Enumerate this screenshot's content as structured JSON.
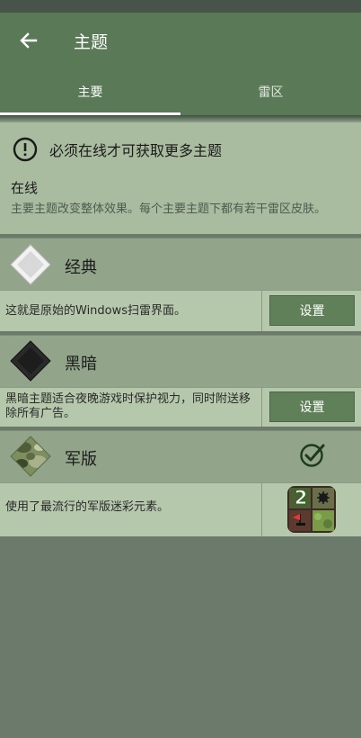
{
  "app": {
    "title": "主题"
  },
  "tabs": [
    {
      "label": "主要"
    },
    {
      "label": "雷区"
    }
  ],
  "notice": {
    "text": "必须在线才可获取更多主题",
    "online_label": "在线",
    "online_desc": "主要主题改变整体效果。每个主要主题下都有若干雷区皮肤。"
  },
  "themes": [
    {
      "name": "经典",
      "desc": "这就是原始的Windows扫雷界面。",
      "button": "设置"
    },
    {
      "name": "黑暗",
      "desc": "黑暗主题适合夜晚游戏时保护视力，同时附送移除所有广告。",
      "button": "设置"
    },
    {
      "name": "军版",
      "desc": "使用了最流行的军版迷彩元素。",
      "badge_number": "2"
    }
  ],
  "icons": [
    "back-arrow-icon",
    "info-circle-icon",
    "diamond-classic-icon",
    "diamond-dark-icon",
    "diamond-camo-icon",
    "checkmark-circle-icon",
    "theme-preview-icon"
  ],
  "colors": {
    "appbar": "#5a7a57",
    "header": "#92a58a",
    "body": "#b6c8ab",
    "button": "#5f8058"
  }
}
